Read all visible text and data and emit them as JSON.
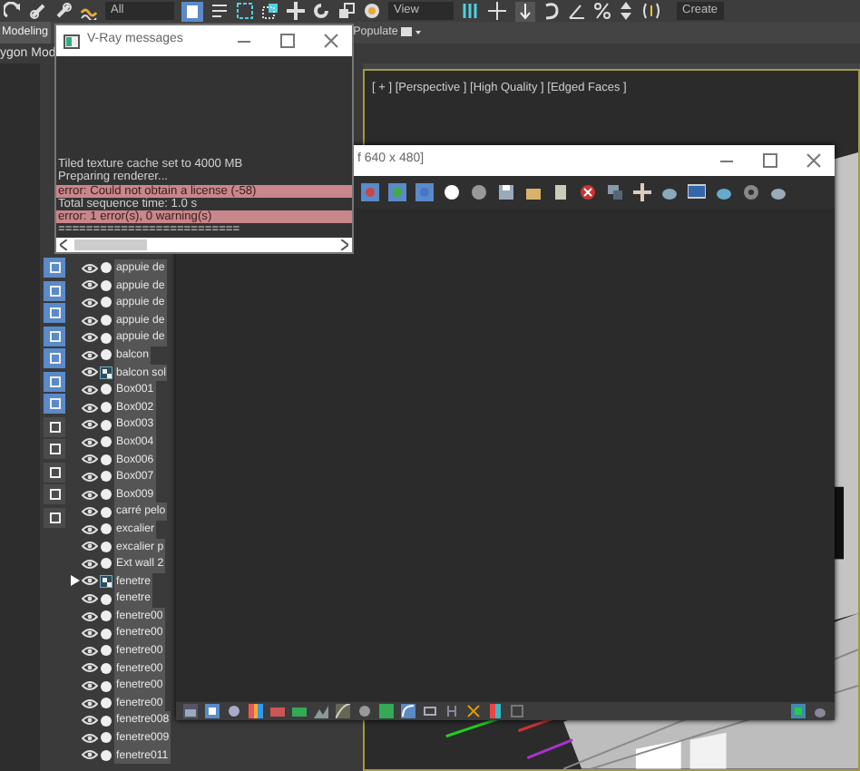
{
  "toolbar": {
    "selection_filter": "All",
    "view_dropdown": "View",
    "create_label": "Create"
  },
  "ribbon": {
    "tabs": [
      {
        "label": "Modeling",
        "selected": true
      },
      {
        "label": "Populate",
        "selected": false
      }
    ],
    "subtitle": "ygon Mod"
  },
  "explorer_toolbar": [
    {
      "on": true
    },
    {
      "on": true
    },
    {
      "on": true
    },
    {
      "on": true
    },
    {
      "on": true
    },
    {
      "on": true
    },
    {
      "on": true
    },
    {
      "on": false
    },
    {
      "on": false
    },
    {
      "on": false
    },
    {
      "on": false
    },
    {
      "on": false
    }
  ],
  "scene_explorer": {
    "items": [
      {
        "name": "appuie de",
        "kind": "object",
        "expandable": false
      },
      {
        "name": "appuie de",
        "kind": "object",
        "expandable": false
      },
      {
        "name": "appuie de",
        "kind": "object",
        "expandable": false
      },
      {
        "name": "appuie de",
        "kind": "object",
        "expandable": false
      },
      {
        "name": "appuie de",
        "kind": "object",
        "expandable": false
      },
      {
        "name": "balcon",
        "kind": "object",
        "expandable": false
      },
      {
        "name": "balcon sol",
        "kind": "group",
        "expandable": false
      },
      {
        "name": "Box001",
        "kind": "object",
        "expandable": false
      },
      {
        "name": "Box002",
        "kind": "object",
        "expandable": false
      },
      {
        "name": "Box003",
        "kind": "object",
        "expandable": false
      },
      {
        "name": "Box004",
        "kind": "object",
        "expandable": false
      },
      {
        "name": "Box006",
        "kind": "object",
        "expandable": false
      },
      {
        "name": "Box007",
        "kind": "object",
        "expandable": false
      },
      {
        "name": "Box009",
        "kind": "object",
        "expandable": false
      },
      {
        "name": "carré pelo",
        "kind": "object",
        "expandable": false
      },
      {
        "name": "excalier",
        "kind": "object",
        "expandable": false
      },
      {
        "name": "excalier p",
        "kind": "object",
        "expandable": false
      },
      {
        "name": "Ext wall 2",
        "kind": "object",
        "expandable": false
      },
      {
        "name": "fenetre",
        "kind": "group",
        "expandable": true
      },
      {
        "name": "fenetre",
        "kind": "object",
        "expandable": false
      },
      {
        "name": "fenetre00",
        "kind": "object",
        "expandable": false
      },
      {
        "name": "fenetre00",
        "kind": "object",
        "expandable": false
      },
      {
        "name": "fenetre00",
        "kind": "object",
        "expandable": false
      },
      {
        "name": "fenetre00",
        "kind": "object",
        "expandable": false
      },
      {
        "name": "fenetre00",
        "kind": "object",
        "expandable": false
      },
      {
        "name": "fenetre00",
        "kind": "object",
        "expandable": false
      },
      {
        "name": "fenetre008",
        "kind": "object",
        "expandable": false
      },
      {
        "name": "fenetre009",
        "kind": "object",
        "expandable": false
      },
      {
        "name": "fenetre011",
        "kind": "object",
        "expandable": false
      }
    ]
  },
  "viewport": {
    "label": "[ + ] [Perspective ] [High Quality ] [Edged Faces ]",
    "active": true
  },
  "frame_buffer": {
    "title": "f 640 x 480]"
  },
  "vray_messages": {
    "title": "V-Ray messages",
    "lines": [
      {
        "text": "Tiled texture cache set to 4000 MB",
        "kind": "info"
      },
      {
        "text": "Preparing renderer...",
        "kind": "info"
      },
      {
        "text": "error: Could not obtain a license (-58)",
        "kind": "error"
      },
      {
        "text": "Total sequence time: 1.0 s",
        "kind": "info"
      },
      {
        "text": "error: 1 error(s), 0 warning(s)",
        "kind": "error"
      },
      {
        "text": "==========================",
        "kind": "info"
      }
    ]
  }
}
